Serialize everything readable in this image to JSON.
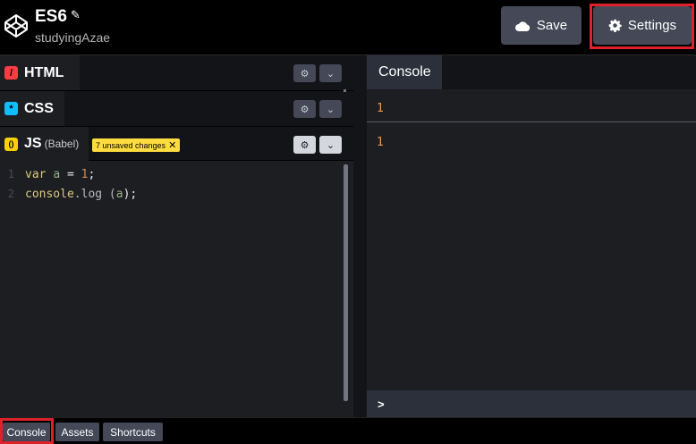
{
  "header": {
    "title": "ES6",
    "owner": "studyingAzae",
    "save_label": "Save",
    "settings_label": "Settings"
  },
  "editors": {
    "html": {
      "label": "HTML",
      "icon": "/",
      "icon_color": "#ff3c41"
    },
    "css": {
      "label": "CSS",
      "icon": "*",
      "icon_color": "#0ebeff"
    },
    "js": {
      "label": "JS",
      "preprocessor": "(Babel)",
      "icon": "()",
      "icon_color": "#fcd000",
      "unsaved_badge": "7 unsaved changes"
    }
  },
  "code": {
    "lines": [
      {
        "number": "1",
        "tokens": [
          "var",
          "a",
          " = ",
          "1",
          ";"
        ]
      },
      {
        "number": "2",
        "tokens": [
          "console",
          ".log (",
          "a",
          ");"
        ]
      }
    ]
  },
  "console": {
    "tab_label": "Console",
    "output_top": "1",
    "output_bottom": "1",
    "prompt": ">"
  },
  "bottom_bar": {
    "console_label": "Console",
    "assets_label": "Assets",
    "shortcuts_label": "Shortcuts"
  },
  "colors": {
    "highlight": "#e0202a",
    "button_bg": "#444857",
    "badge_bg": "#ffdd40",
    "console_output": "#e99b4d"
  }
}
